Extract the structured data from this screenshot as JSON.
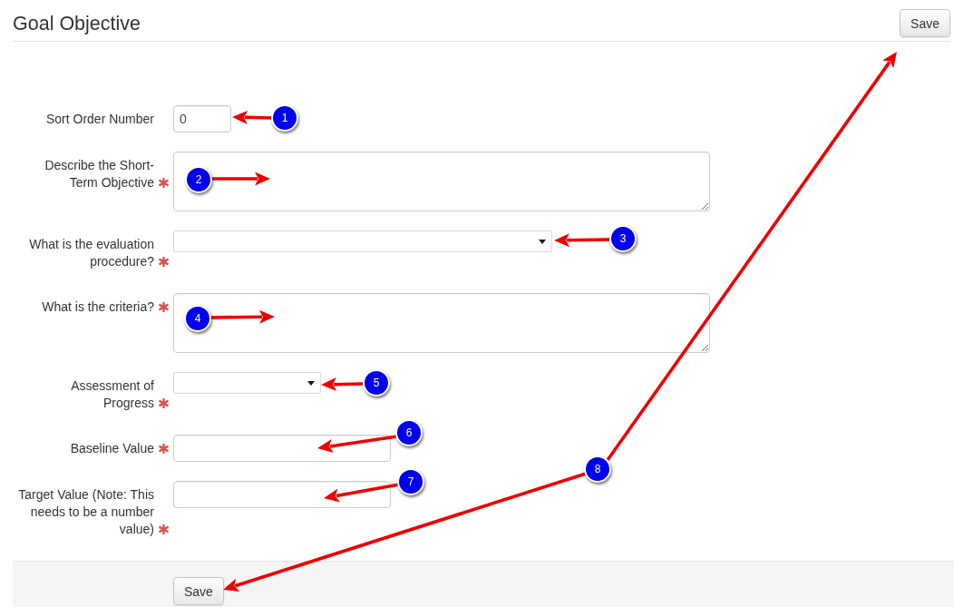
{
  "header": {
    "title": "Goal Objective",
    "save_button": "Save"
  },
  "form": {
    "fields": [
      {
        "label": "Sort Order Number",
        "required": false,
        "kind": "number",
        "value": "0"
      },
      {
        "label": "Describe the Short-Term Objective",
        "required": true,
        "kind": "textarea"
      },
      {
        "label": "What is the evaluation procedure?",
        "required": true,
        "kind": "select"
      },
      {
        "label": "What is the criteria?",
        "required": true,
        "kind": "textarea"
      },
      {
        "label": "Assessment of Progress",
        "required": true,
        "kind": "select"
      },
      {
        "label": "Baseline Value",
        "required": true,
        "kind": "text"
      },
      {
        "label": "Target Value (Note: This needs to be a number value)",
        "required": true,
        "kind": "text"
      }
    ]
  },
  "footer": {
    "save_button": "Save"
  },
  "callouts": [
    {
      "number": "1"
    },
    {
      "number": "2"
    },
    {
      "number": "3"
    },
    {
      "number": "4"
    },
    {
      "number": "5"
    },
    {
      "number": "6"
    },
    {
      "number": "7"
    },
    {
      "number": "8"
    }
  ]
}
